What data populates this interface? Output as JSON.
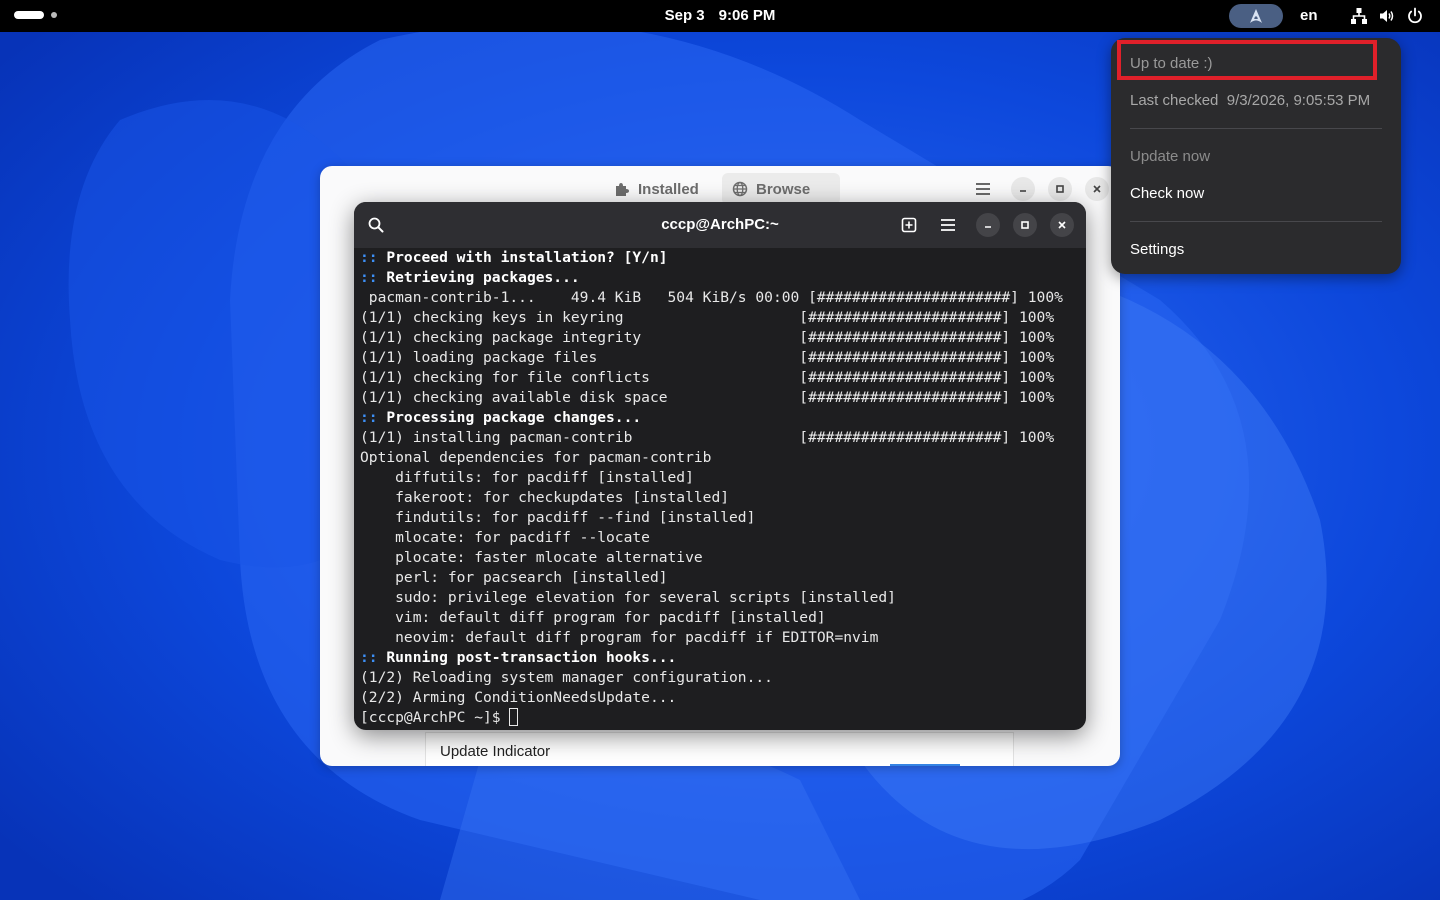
{
  "topbar": {
    "date": "Sep 3",
    "time": "9:06 PM",
    "language": "en"
  },
  "software_window": {
    "tabs": [
      {
        "label": "Installed",
        "icon": "puzzle-icon"
      },
      {
        "label": "Browse",
        "icon": "globe-icon"
      }
    ],
    "list_item_label": "Update Indicator"
  },
  "terminal": {
    "title": "cccp@ArchPC:~",
    "lines": [
      {
        "prefix": "::",
        "text": " Proceed with installation? [Y/n]",
        "bold": true
      },
      {
        "prefix": "::",
        "text": " Retrieving packages...",
        "bold": true
      },
      {
        "prefix": "",
        "text": " pacman-contrib-1...    49.4 KiB   504 KiB/s 00:00 [######################] 100%",
        "bold": false
      },
      {
        "prefix": "",
        "text": "(1/1) checking keys in keyring                    [######################] 100%",
        "bold": false
      },
      {
        "prefix": "",
        "text": "(1/1) checking package integrity                  [######################] 100%",
        "bold": false
      },
      {
        "prefix": "",
        "text": "(1/1) loading package files                       [######################] 100%",
        "bold": false
      },
      {
        "prefix": "",
        "text": "(1/1) checking for file conflicts                 [######################] 100%",
        "bold": false
      },
      {
        "prefix": "",
        "text": "(1/1) checking available disk space               [######################] 100%",
        "bold": false
      },
      {
        "prefix": "::",
        "text": " Processing package changes...",
        "bold": true
      },
      {
        "prefix": "",
        "text": "(1/1) installing pacman-contrib                   [######################] 100%",
        "bold": false
      },
      {
        "prefix": "",
        "text": "Optional dependencies for pacman-contrib",
        "bold": false
      },
      {
        "prefix": "",
        "text": "    diffutils: for pacdiff [installed]",
        "bold": false
      },
      {
        "prefix": "",
        "text": "    fakeroot: for checkupdates [installed]",
        "bold": false
      },
      {
        "prefix": "",
        "text": "    findutils: for pacdiff --find [installed]",
        "bold": false
      },
      {
        "prefix": "",
        "text": "    mlocate: for pacdiff --locate",
        "bold": false
      },
      {
        "prefix": "",
        "text": "    plocate: faster mlocate alternative",
        "bold": false
      },
      {
        "prefix": "",
        "text": "    perl: for pacsearch [installed]",
        "bold": false
      },
      {
        "prefix": "",
        "text": "    sudo: privilege elevation for several scripts [installed]",
        "bold": false
      },
      {
        "prefix": "",
        "text": "    vim: default diff program for pacdiff [installed]",
        "bold": false
      },
      {
        "prefix": "",
        "text": "    neovim: default diff program for pacdiff if EDITOR=nvim",
        "bold": false
      },
      {
        "prefix": "::",
        "text": " Running post-transaction hooks...",
        "bold": true
      },
      {
        "prefix": "",
        "text": "(1/2) Reloading system manager configuration...",
        "bold": false
      },
      {
        "prefix": "",
        "text": "(2/2) Arming ConditionNeedsUpdate...",
        "bold": false
      }
    ],
    "prompt": "[cccp@ArchPC ~]$ "
  },
  "update_menu": {
    "status": "Up to date :)",
    "last_checked_label": "Last checked",
    "last_checked_value": "9/3/2026, 9:05:53 PM",
    "update_now": "Update now",
    "check_now": "Check now",
    "settings": "Settings"
  },
  "colors": {
    "wallpaper": "#0b3fd6",
    "terminal_bg": "#1e1e20",
    "menu_bg": "#2b2b2d",
    "prompt_prefix": "#3d8ff5",
    "highlight": "#e0202a"
  }
}
